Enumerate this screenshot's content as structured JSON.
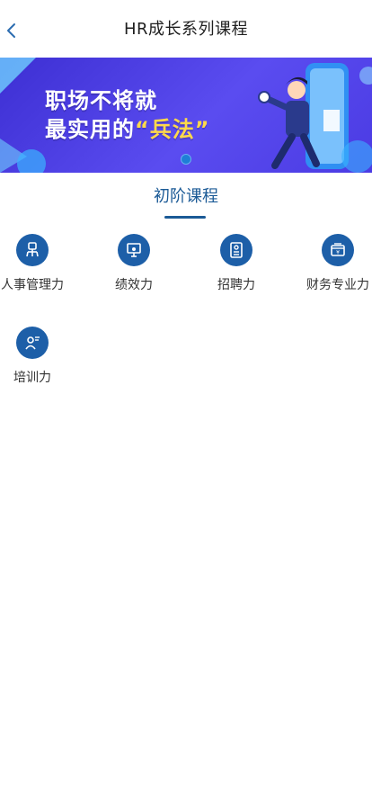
{
  "header": {
    "title": "HR成长系列课程",
    "back_icon": "chevron-left-icon"
  },
  "banner": {
    "line1": "职场不将就",
    "line2_prefix": "最实用的",
    "line2_highlight": "“兵法”",
    "background_color": "#4b3be3",
    "highlight_color": "#ffd94a",
    "carousel_active_index": 1,
    "carousel_total": 1
  },
  "section": {
    "title": "初阶课程",
    "accent_color": "#1b5a96"
  },
  "courses": [
    {
      "label": "人事管理力",
      "icon": "org-chart-icon"
    },
    {
      "label": "绩效力",
      "icon": "presentation-board-icon"
    },
    {
      "label": "招聘力",
      "icon": "resume-icon"
    },
    {
      "label": "财务专业力",
      "icon": "cash-register-icon"
    },
    {
      "label": "培训力",
      "icon": "trainer-icon"
    }
  ]
}
